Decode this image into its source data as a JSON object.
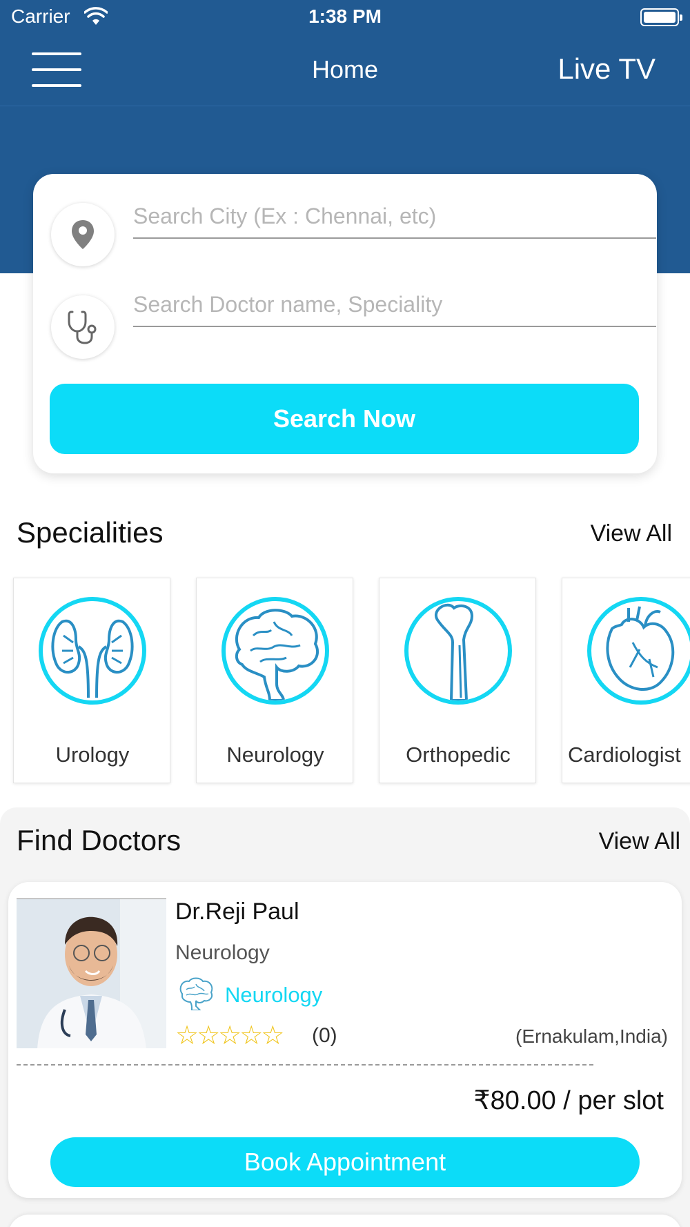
{
  "status_bar": {
    "carrier": "Carrier",
    "time": "1:38 PM"
  },
  "nav": {
    "title": "Home",
    "live_tv": "Live TV"
  },
  "search": {
    "city_placeholder": "Search City (Ex : Chennai, etc)",
    "doctor_placeholder": "Search Doctor name, Speciality",
    "button_label": "Search Now"
  },
  "specialities": {
    "title": "Specialities",
    "view_all": "View All",
    "items": [
      {
        "label": "Urology",
        "icon": "kidney-icon"
      },
      {
        "label": "Neurology",
        "icon": "brain-icon"
      },
      {
        "label": "Orthopedic",
        "icon": "bone-icon"
      },
      {
        "label": "Cardiologist",
        "icon": "heart-icon"
      }
    ]
  },
  "find_doctors": {
    "title": "Find Doctors",
    "view_all": "View All",
    "doctors": [
      {
        "name": "Dr.Reji  Paul",
        "speciality": "Neurology",
        "speciality_link": "Neurology",
        "stars": "☆☆☆☆☆",
        "rating_count": "(0)",
        "location": "(Ernakulam,India)",
        "price": "₹80.00 / per slot",
        "book_label": "Book Appointment"
      }
    ]
  },
  "colors": {
    "header": "#215a92",
    "accent": "#0cdcf8",
    "star": "#f0c419"
  }
}
